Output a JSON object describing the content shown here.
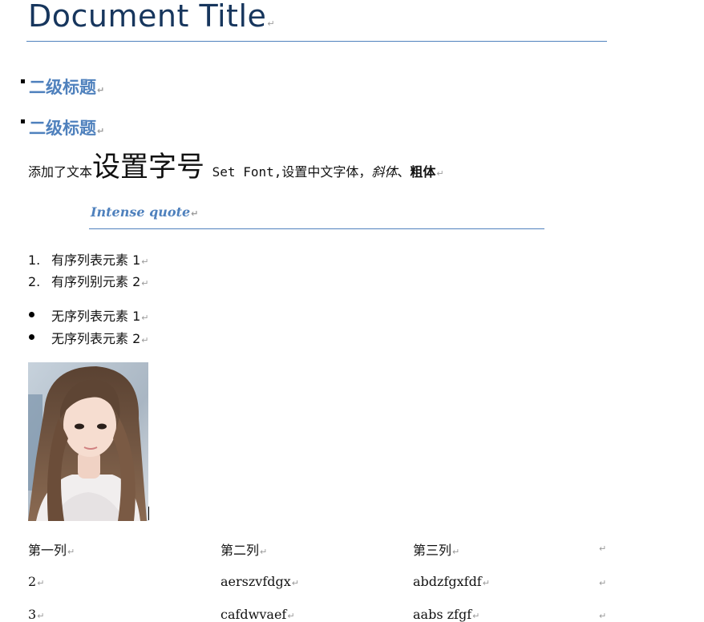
{
  "document": {
    "title": "Document Title",
    "headings": [
      "二级标题",
      "二级标题"
    ],
    "paragraph": {
      "prefix": "添加了文本",
      "large": "设置字号",
      "mono": " Set Font,",
      "middle": "设置中文字体，",
      "italic": "斜体",
      "separator": "、",
      "bold": "粗体"
    },
    "intense_quote": "Intense quote",
    "ordered_list": [
      {
        "number": "1.",
        "text": "有序列表元素 1"
      },
      {
        "number": "2.",
        "text": "有序列别元素 2"
      }
    ],
    "unordered_list": [
      "无序列表元素 1",
      "无序列表元素 2"
    ],
    "paragraph_mark": "↵",
    "table": {
      "header": [
        "第一列",
        "第二列",
        "第三列"
      ],
      "rows": [
        [
          "2",
          "aerszvfdgx",
          "abdzfgxfdf"
        ],
        [
          "3",
          "cafdwvaef",
          "aabs zfgf"
        ]
      ]
    }
  }
}
